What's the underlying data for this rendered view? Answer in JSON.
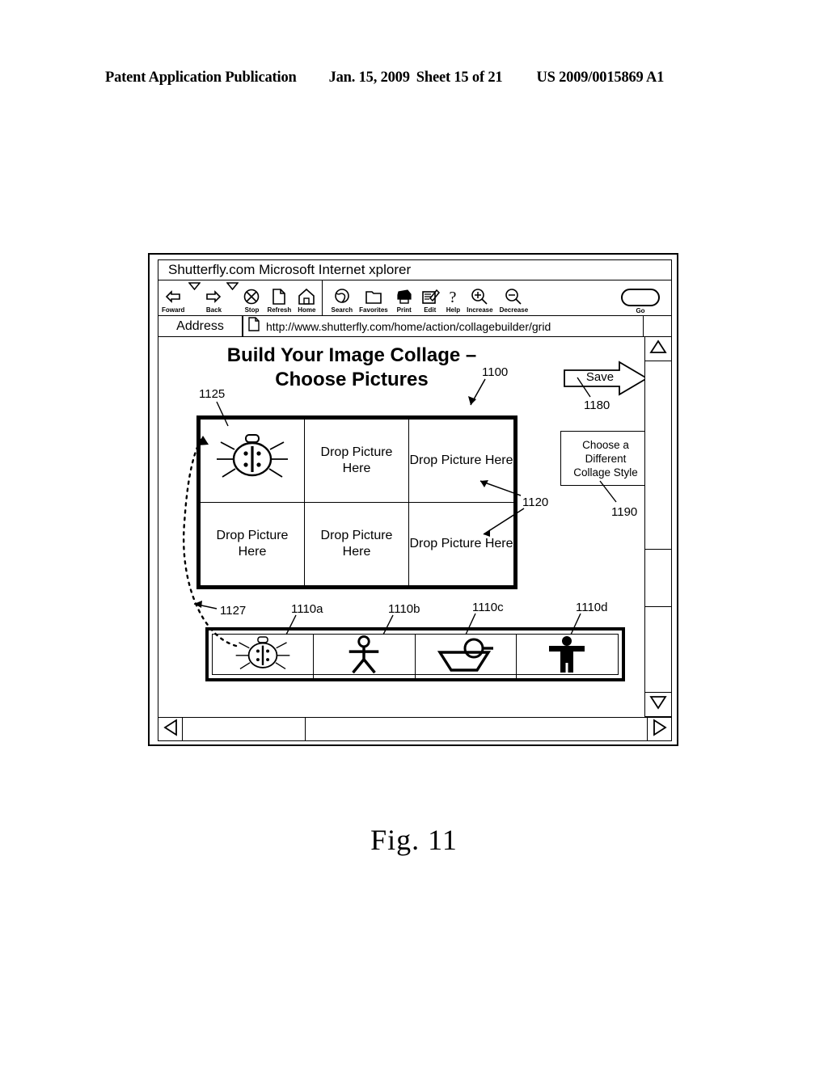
{
  "patent_header": {
    "publication": "Patent Application Publication",
    "date": "Jan. 15, 2009",
    "sheet": "Sheet 15 of 21",
    "number": "US 2009/0015869 A1"
  },
  "figure": {
    "caption": "Fig. 11"
  },
  "browser": {
    "title": "Shutterfly.com Microsoft Internet xplorer",
    "toolbar": {
      "buttons": [
        {
          "label": "Foward",
          "icon": "back-arrow-icon"
        },
        {
          "label": "Back",
          "icon": "forward-arrow-icon"
        },
        {
          "label": "Stop",
          "icon": "stop-x-circle-icon"
        },
        {
          "label": "Refresh",
          "icon": "page-refresh-icon"
        },
        {
          "label": "Home",
          "icon": "house-icon"
        },
        {
          "label": "Search",
          "icon": "globe-search-icon"
        },
        {
          "label": "Favorites",
          "icon": "folder-favorites-icon"
        },
        {
          "label": "Print",
          "icon": "printer-icon"
        },
        {
          "label": "Edit",
          "icon": "edit-pencil-icon"
        },
        {
          "label": "Help",
          "icon": "question-mark-icon"
        },
        {
          "label": "Increase",
          "icon": "zoom-in-icon"
        },
        {
          "label": "Decrease",
          "icon": "zoom-out-icon"
        }
      ],
      "go_label": "Go"
    },
    "address": {
      "label": "Address",
      "url": "http://www.shutterfly.com/home/action/collagebuilder/grid"
    }
  },
  "page": {
    "heading_line1": "Build Your Image Collage –",
    "heading_line2": "Choose Pictures",
    "save_label": "Save",
    "style_button": {
      "line1": "Choose a",
      "line2": "Different",
      "line3": "Collage Style"
    },
    "collage_cells": [
      {
        "type": "image",
        "icon": "ladybug-icon",
        "text": ""
      },
      {
        "type": "placeholder",
        "icon": "",
        "text": "Drop Picture Here"
      },
      {
        "type": "placeholder",
        "icon": "",
        "text": "Drop Picture Here"
      },
      {
        "type": "placeholder",
        "icon": "",
        "text": "Drop Picture Here"
      },
      {
        "type": "placeholder",
        "icon": "",
        "text": "Drop Picture Here"
      },
      {
        "type": "placeholder",
        "icon": "",
        "text": "Drop Picture Here"
      }
    ],
    "tray_thumbnails": [
      {
        "icon": "ladybug-icon"
      },
      {
        "icon": "stick-figure-icon"
      },
      {
        "icon": "boat-sun-icon"
      },
      {
        "icon": "bold-person-icon"
      }
    ]
  },
  "reference_numerals": {
    "heading": "1125",
    "collage_area": "1100",
    "cell_callout": "1120",
    "save": "1180",
    "style": "1190",
    "drag_path": "1127",
    "thumb_a": "1110a",
    "thumb_b": "1110b",
    "thumb_c": "1110c",
    "thumb_d": "1110d"
  }
}
